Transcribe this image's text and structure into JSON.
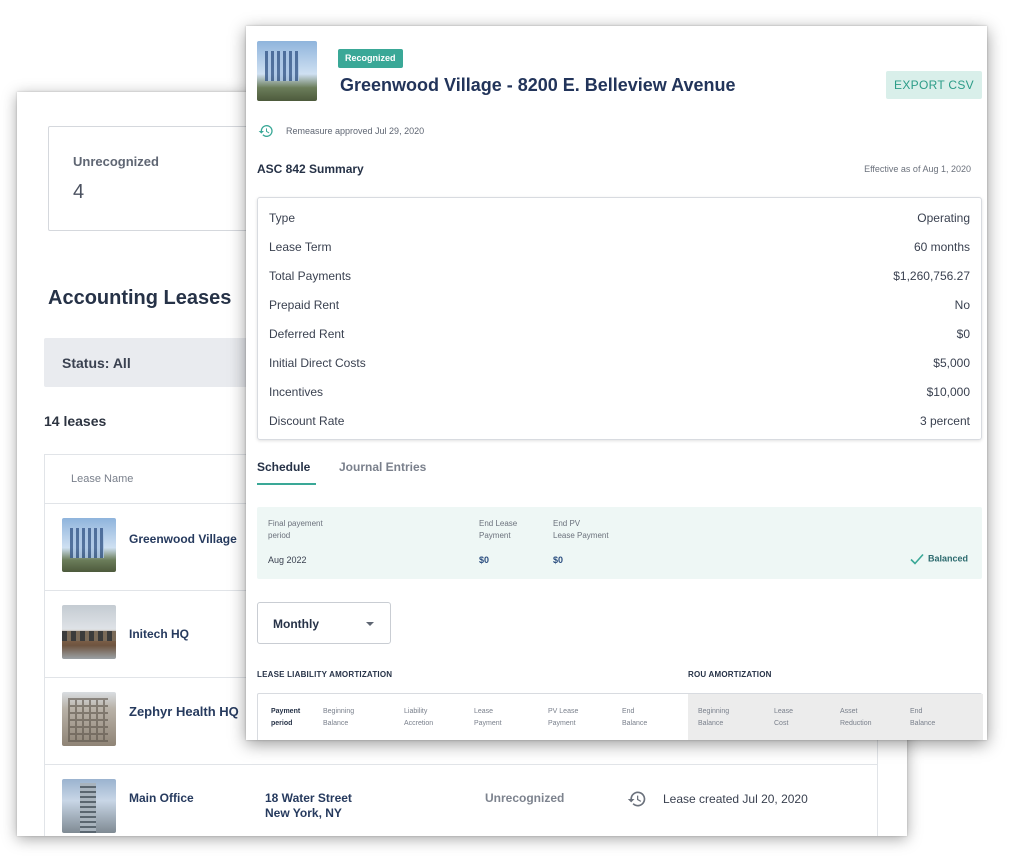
{
  "back": {
    "stat_card": {
      "label": "Unrecognized",
      "value": "4"
    },
    "title": "Accounting Leases",
    "filter_label": "Status: All",
    "lease_count": "14 leases",
    "table_header": {
      "lease_name": "Lease Name"
    },
    "rows": [
      {
        "name": "Greenwood Village",
        "thumb": "glass-office-building"
      },
      {
        "name": "Initech HQ",
        "thumb": "low-commercial-building"
      },
      {
        "name": "Zephyr Health HQ",
        "thumb": "historic-brick-building"
      },
      {
        "name": "Main Office",
        "thumb": "skyscraper",
        "address_line1": "18 Water Street",
        "address_line2": "New York, NY",
        "status": "Unrecognized",
        "history_icon": "history-icon",
        "history_text": "Lease created Jul 20, 2020"
      }
    ]
  },
  "detail": {
    "status_chip": "Recognized",
    "title": "Greenwood Village - 8200 E. Belleview Avenue",
    "export_button": "EXPORT CSV",
    "remeasure_text": "Remeasure approved Jul 29, 2020",
    "summary_title": "ASC 842 Summary",
    "effective_text": "Effective as of Aug 1, 2020",
    "summary": [
      {
        "label": "Type",
        "value": "Operating"
      },
      {
        "label": "Lease Term",
        "value": "60 months"
      },
      {
        "label": "Total Payments",
        "value": "$1,260,756.27"
      },
      {
        "label": "Prepaid Rent",
        "value": "No"
      },
      {
        "label": "Deferred Rent",
        "value": "$0"
      },
      {
        "label": "Initial Direct Costs",
        "value": "$5,000"
      },
      {
        "label": "Incentives",
        "value": "$10,000"
      },
      {
        "label": "Discount Rate",
        "value": "3 percent"
      }
    ],
    "tabs": {
      "schedule": "Schedule",
      "journal": "Journal Entries"
    },
    "balance": {
      "final_period_label_1": "Final payement",
      "final_period_label_2": "period",
      "final_period_value": "Aug 2022",
      "end_lease_label_1": "End Lease",
      "end_lease_label_2": "Payment",
      "end_lease_value": "$0",
      "end_pv_label_1": "End PV",
      "end_pv_label_2": "Lease Payment",
      "end_pv_value": "$0",
      "balanced_label": "Balanced"
    },
    "period_select": "Monthly",
    "liability_title": "LEASE LIABILITY AMORTIZATION",
    "rou_title": "ROU AMORTIZATION",
    "amort_headers": {
      "payment_1": "Payment",
      "payment_2": "period",
      "beg_1": "Beginning",
      "beg_2": "Balance",
      "accr_1": "Liability",
      "accr_2": "Accretion",
      "lp_1": "Lease",
      "lp_2": "Payment",
      "pv_1": "PV Lease",
      "pv_2": "Payment",
      "end_1": "End",
      "end_2": "Balance",
      "rou_beg_1": "Beginning",
      "rou_beg_2": "Balance",
      "cost_1": "Lease",
      "cost_2": "Cost",
      "red_1": "Asset",
      "red_2": "Reduction",
      "rou_end_1": "End",
      "rou_end_2": "Balance"
    }
  },
  "colors": {
    "accent": "#3aa897",
    "navy": "#22345a",
    "balance_bg": "#eef7f5"
  }
}
